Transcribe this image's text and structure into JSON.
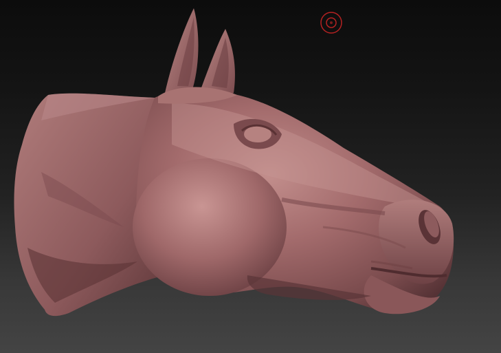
{
  "viewport": {
    "background_top": "#0c0c0c",
    "background_bottom": "#444444"
  },
  "model": {
    "material_color": "#9a6466",
    "highlight_color": "#c08a88",
    "shadow_color": "#4a2a2c"
  },
  "brush_cursor": {
    "icon": "circle-brush-cursor-icon",
    "color": "#b52222"
  }
}
